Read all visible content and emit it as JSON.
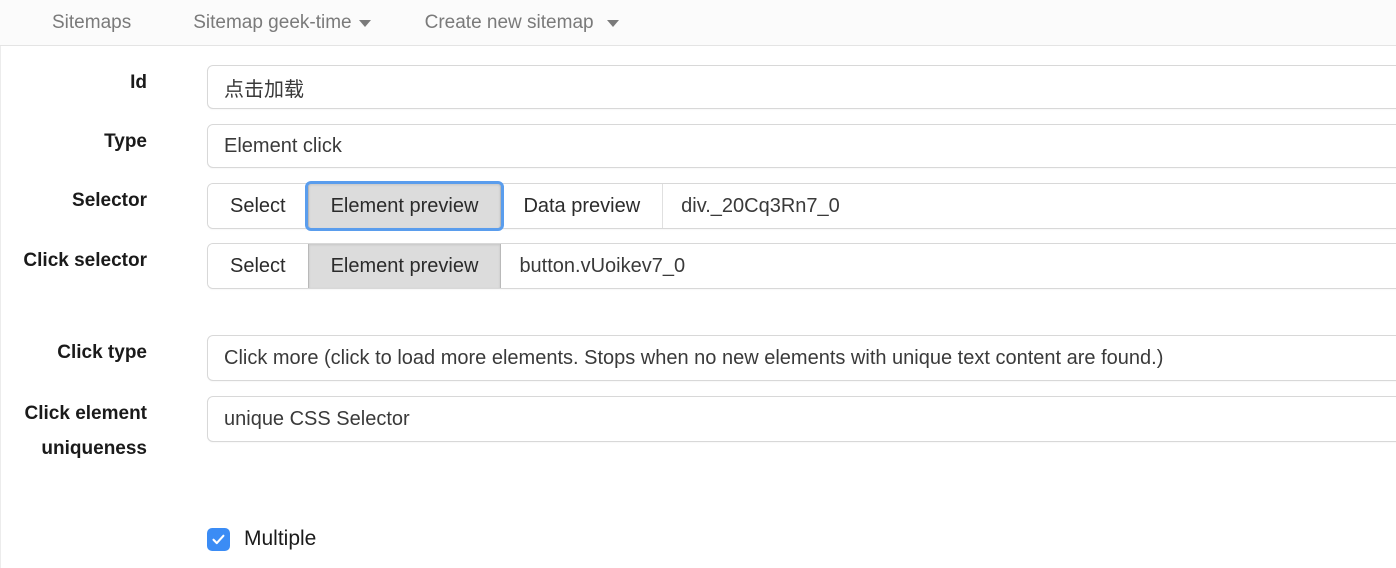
{
  "navbar": {
    "items": [
      {
        "label": "Sitemaps",
        "has_caret": false
      },
      {
        "label": "Sitemap geek-time",
        "has_caret": true
      },
      {
        "label": "Create new sitemap",
        "has_caret": true
      }
    ]
  },
  "form": {
    "id_row": {
      "label": "Id",
      "value": "点击加载"
    },
    "type_row": {
      "label": "Type",
      "value": "Element click"
    },
    "selector_row": {
      "label": "Selector",
      "select_label": "Select",
      "element_preview_label": "Element preview",
      "data_preview_label": "Data preview",
      "value": "div._20Cq3Rn7_0"
    },
    "click_selector_row": {
      "label": "Click selector",
      "select_label": "Select",
      "element_preview_label": "Element preview",
      "value": "button.vUoikev7_0"
    },
    "click_type_row": {
      "label": "Click type",
      "value": "Click more (click to load more elements. Stops when no new elements with unique text content are found.)"
    },
    "click_uniqueness_row": {
      "label": "Click element uniqueness",
      "value": "unique CSS Selector"
    },
    "multiple_row": {
      "label": "Multiple",
      "checked": true
    }
  },
  "colors": {
    "focus_ring": "#5a9ded",
    "checkbox_blue": "#3b8cf5",
    "nav_text": "#7a7a7a"
  }
}
